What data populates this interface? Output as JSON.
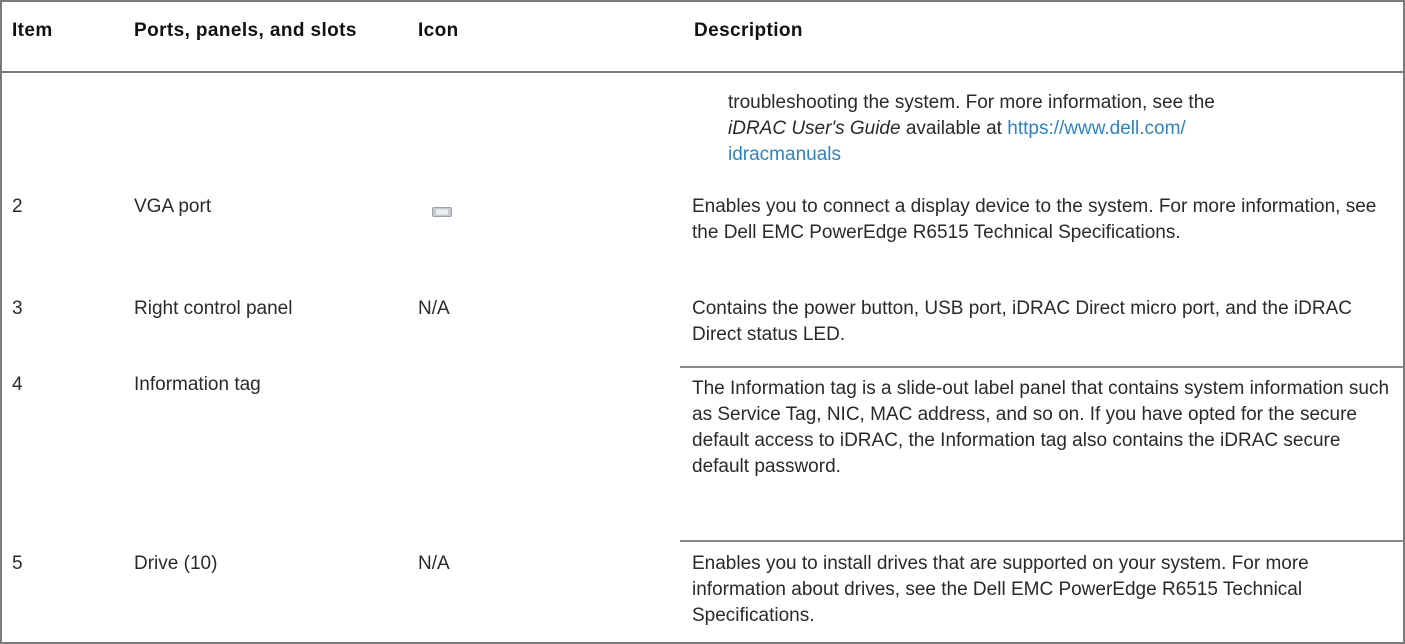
{
  "table": {
    "headers": {
      "item": "Item",
      "ports": "Ports, panels, and slots",
      "icon": "Icon",
      "description": "Description"
    },
    "continued_row": {
      "text_start": "troubleshooting the system. For more information, see the",
      "guide_title": "iDRAC User's Guide",
      "available_at": " available at ",
      "link_part1": "https://www.dell.com/",
      "link_part2": "idracmanuals"
    },
    "rows": [
      {
        "item": "2",
        "name": "VGA port",
        "icon": "vga-port-icon",
        "description": "Enables you to connect a display device to the system. For more information, see the Dell EMC PowerEdge R6515 Technical Specifications."
      },
      {
        "item": "3",
        "name": "Right control panel",
        "icon": "N/A",
        "description": "Contains the power button, USB port, iDRAC Direct micro port, and the iDRAC Direct status LED."
      },
      {
        "item": "4",
        "name": "Information tag",
        "icon": "",
        "description": "The Information tag is a slide-out label panel that contains system information such as Service Tag, NIC, MAC address, and so on. If you have opted for the secure default access to iDRAC, the Information tag also contains the iDRAC secure default password."
      },
      {
        "item": "5",
        "name": "Drive (10)",
        "icon": "N/A",
        "description": "Enables you to install drives that are supported on your system. For more information about drives, see the Dell EMC PowerEdge R6515 Technical Specifications."
      }
    ]
  },
  "colors": {
    "link": "#2f83c0",
    "rule": "#7a7a7a",
    "text": "#2a2a2a"
  }
}
